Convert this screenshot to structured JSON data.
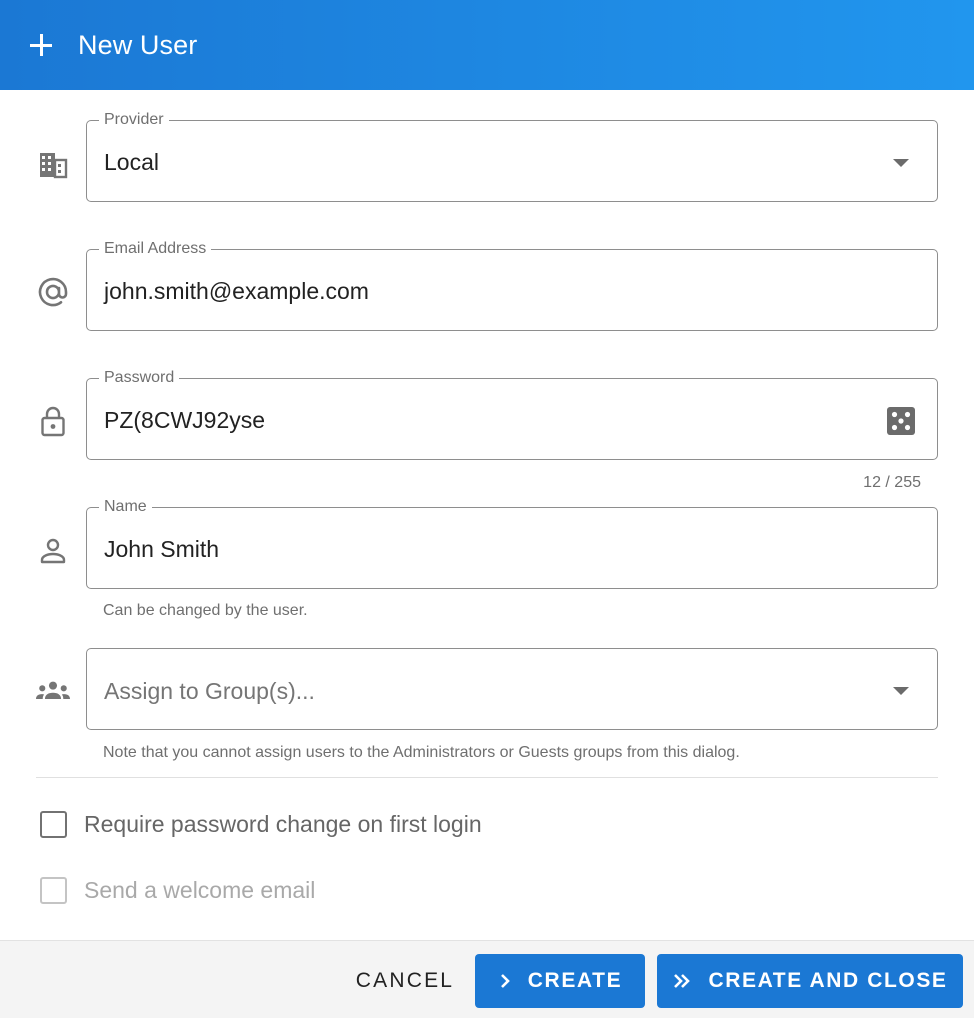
{
  "header": {
    "icon": "plus-icon",
    "title": "New User",
    "accent_color": "#1b78d4"
  },
  "form": {
    "provider": {
      "icon": "building-icon",
      "label": "Provider",
      "value": "Local"
    },
    "email": {
      "icon": "at-sign-icon",
      "label": "Email Address",
      "value": "john.smith@example.com"
    },
    "password": {
      "icon": "lock-icon",
      "label": "Password",
      "value": "PZ(8CWJ92yse",
      "generate_icon": "dice-icon",
      "counter": "12 / 255"
    },
    "name": {
      "icon": "person-icon",
      "label": "Name",
      "value": "John Smith",
      "hint": "Can be changed by the user."
    },
    "groups": {
      "icon": "group-icon",
      "placeholder": "Assign to Group(s)...",
      "hint": "Note that you cannot assign users to the Administrators or Guests groups from this dialog."
    },
    "require_password_change": {
      "label": "Require password change on first login",
      "checked": false,
      "disabled": false
    },
    "send_welcome_email": {
      "label": "Send a welcome email",
      "checked": false,
      "disabled": true
    }
  },
  "footer": {
    "cancel_label": "Cancel",
    "create_label": "Create",
    "create_close_label": "Create and Close"
  }
}
